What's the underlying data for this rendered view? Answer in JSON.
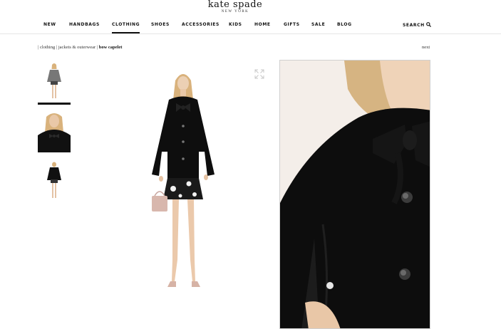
{
  "brand": {
    "name": "kate spade",
    "tagline": "NEW YORK"
  },
  "nav": {
    "items": [
      {
        "label": "NEW"
      },
      {
        "label": "HANDBAGS"
      },
      {
        "label": "CLOTHING"
      },
      {
        "label": "SHOES"
      },
      {
        "label": "ACCESSORIES"
      },
      {
        "label": "KIDS"
      },
      {
        "label": "HOME"
      },
      {
        "label": "GIFTS"
      },
      {
        "label": "SALE"
      },
      {
        "label": "BLOG"
      }
    ],
    "active": "CLOTHING",
    "search_label": "SEARCH",
    "search_icon": "search-icon"
  },
  "breadcrumb": {
    "items": [
      "clothing",
      "jackets & outerwear",
      "bow capelet"
    ],
    "separator": "|"
  },
  "next_label": "next",
  "thumbnails": [
    {
      "name": "full-length-front",
      "active": true
    },
    {
      "name": "upper-body-closeup",
      "active": false
    },
    {
      "name": "full-length-back",
      "active": false
    }
  ],
  "icons": {
    "expand": "expand-icon"
  },
  "colors": {
    "accent": "#111111",
    "divider": "#e6e6e6"
  }
}
